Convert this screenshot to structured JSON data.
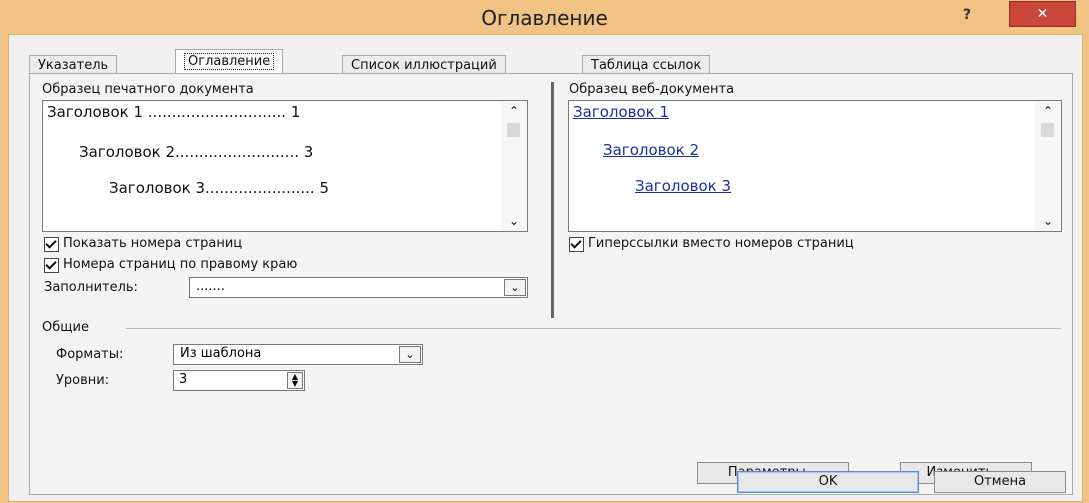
{
  "window": {
    "title": "Оглавление",
    "help_label": "?",
    "close_label": "✕"
  },
  "tabs": [
    {
      "label": "Указатель",
      "active": false
    },
    {
      "label": "Оглавление",
      "active": true
    },
    {
      "label": "Список иллюстраций",
      "active": false
    },
    {
      "label": "Таблица ссылок",
      "active": false
    }
  ],
  "print_preview": {
    "label": "Образец печатного документа",
    "lines": [
      "Заголовок 1 ............................. 1",
      "Заголовок 2.......................... 3",
      "Заголовок 3....................... 5"
    ]
  },
  "web_preview": {
    "label": "Образец веб-документа",
    "links": [
      "Заголовок 1",
      "Заголовок 2",
      "Заголовок 3"
    ]
  },
  "options": {
    "show_page_numbers": "Показать номера страниц",
    "right_align": "Номера страниц по правому краю",
    "hyperlinks": "Гиперссылки вместо номеров страниц",
    "leader_label": "Заполнитель:",
    "leader_value": "......."
  },
  "general": {
    "group_label": "Общие",
    "formats_label": "Форматы:",
    "formats_value": "Из шаблона",
    "levels_label": "Уровни:",
    "levels_value": "3"
  },
  "buttons": {
    "options": "Параметры...",
    "modify": "Изменить...",
    "ok": "OK",
    "cancel": "Отмена"
  }
}
